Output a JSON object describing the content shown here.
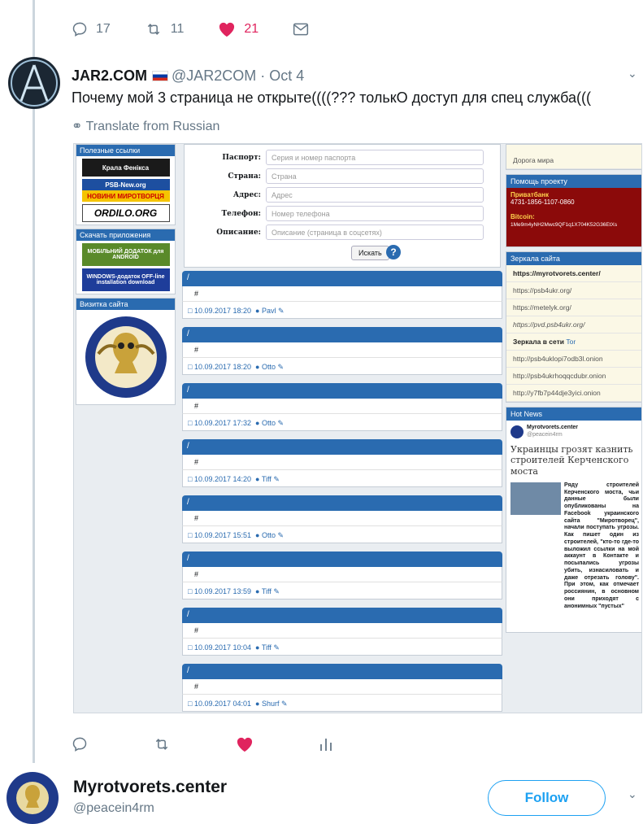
{
  "top_actions": {
    "replies": "17",
    "retweets": "11",
    "likes": "21"
  },
  "tweet": {
    "display_name": "JAR2.COM",
    "handle_date": "@JAR2COM · Oct 4",
    "text": "Почему мой 3 страница не открыте((((??? толькО доступ для спец служба(((",
    "translate": "Translate from Russian"
  },
  "screenshot": {
    "left": {
      "partners_header": "Полезные ссылки",
      "banners": [
        "Крала Фенікса",
        "PSB-New.org",
        "НОВИНИ МИРОТВОРЦЯ",
        "ORDILO.ORG"
      ],
      "apps_header": "Скачать приложения",
      "app_android": "МОБІЛЬНИЙ ДОДАТОК для ANDROID",
      "app_windows": "WINDOWS-додаток OFF-line installation download",
      "card_header": "Визитка сайта",
      "seal_text": "NEC CAPTAT MUSCAS"
    },
    "form": {
      "fields": [
        {
          "label": "Паспорт:",
          "placeholder": "Серия и номер паспорта"
        },
        {
          "label": "Страна:",
          "placeholder": "Страна"
        },
        {
          "label": "Адрес:",
          "placeholder": "Адрес"
        },
        {
          "label": "Телефон:",
          "placeholder": "Номер телефона"
        },
        {
          "label": "Описание:",
          "placeholder": "Описание (страница в соцсетях)"
        }
      ],
      "search_button": "Искать",
      "help": "?"
    },
    "posts": [
      {
        "slash": "/",
        "mark": "#",
        "date": "10.09.2017 18:20",
        "author": "Pavl"
      },
      {
        "slash": "/",
        "mark": "#",
        "date": "10.09.2017 18:20",
        "author": "Otto"
      },
      {
        "slash": "/",
        "mark": "#",
        "date": "10.09.2017 17:32",
        "author": "Otto"
      },
      {
        "slash": "/",
        "mark": "#",
        "date": "10.09.2017 14:20",
        "author": "Tiff"
      },
      {
        "slash": "/",
        "mark": "#",
        "date": "10.09.2017 15:51",
        "author": "Otto"
      },
      {
        "slash": "/",
        "mark": "#",
        "date": "10.09.2017 13:59",
        "author": "Tiff"
      },
      {
        "slash": "/",
        "mark": "#",
        "date": "10.09.2017 10:04",
        "author": "Tiff"
      },
      {
        "slash": "/",
        "mark": "#",
        "date": "10.09.2017 04:01",
        "author": "Shurf"
      }
    ],
    "right": {
      "road": "Дорога мира",
      "help_header": "Помощь проекту",
      "privat_label": "Приватбанк",
      "privat_number": "4731-1856-1107-0860",
      "bitcoin_label": "Bitcoin:",
      "bitcoin_addr": "1Me9m4yNH2Mwc9QF1q1X704K52G36EtXs",
      "mirrors_header": "Зеркала сайта",
      "mirrors": [
        "https://myrotvorets.center/",
        "https://psb4ukr.org/",
        "https://metelyk.org/",
        "https://pvd.psb4ukr.org/"
      ],
      "tor_label": "Зеркала в сети",
      "tor_word": "Tor",
      "onions": [
        "http://psb4uklopi7odb3l.onion",
        "http://psb4ukrhoqqcdubr.onion",
        "http://y7fb7p44dje3yici.onion"
      ],
      "news_header": "Hot News",
      "news_account": "Myrotvorets.center",
      "news_handle": "@peacein4rm",
      "news_title": "Украинцы грозят казнить строителей Керченского моста",
      "news_body": "Ряду строителей Керченского моста, чьи данные были опубликованы на Facebook украинского сайта \"Миротворец\", начали поступать угрозы. Как пишет один из строителей, \"кто-то где-то выложил ссылки на мой аккаунт в Контакте и посыпались угрозы убить, изнасиловать и даже отрезать голову\". При этом, как отмечает россиянин, в основном они приходят с анонимных \"пустых\""
    }
  },
  "follow_account": {
    "name": "Myrotvorets.center",
    "handle": "@peacein4rm",
    "button": "Follow"
  },
  "colors": {
    "accent": "#1da1f2",
    "like": "#e0245e",
    "site_blue": "#2a6bb0"
  }
}
